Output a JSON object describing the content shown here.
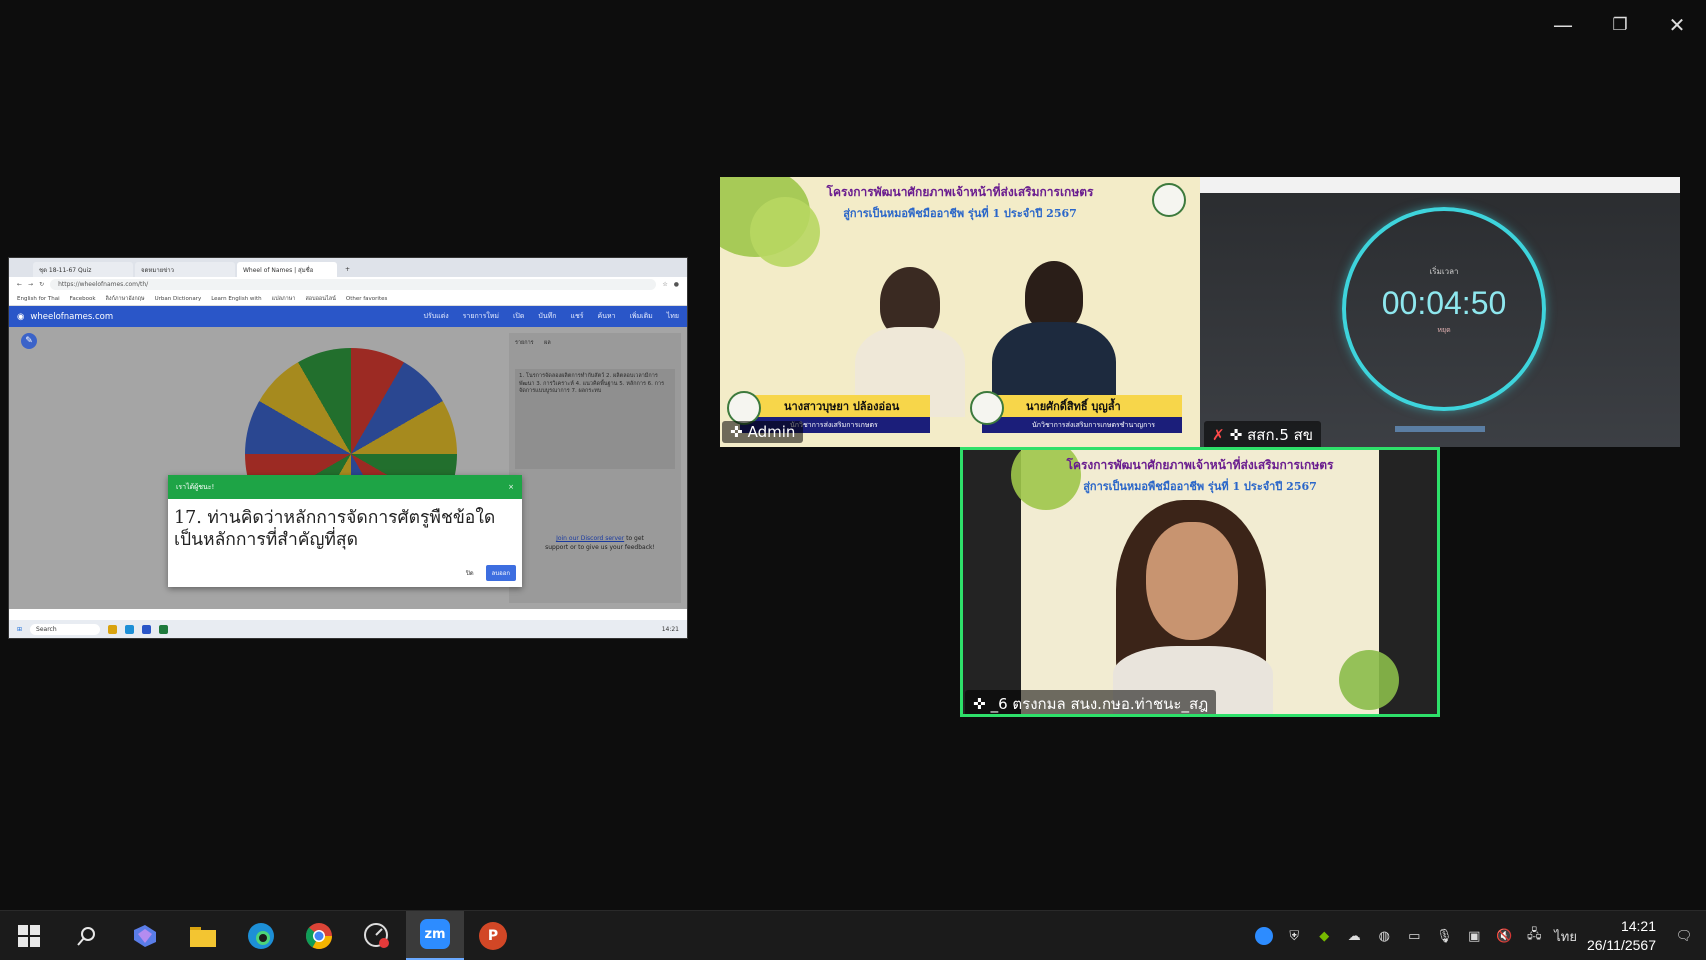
{
  "window": {
    "minimize": "—",
    "restore": "❐",
    "close": "✕"
  },
  "share": {
    "tabs": [
      "ชุด 18-11-67 Quiz",
      "จดหมายข่าว",
      "Wheel of Names | สุ่มชื่อ"
    ],
    "url": "https://wheelofnames.com/th/",
    "bookmarks": [
      "English for Thai",
      "Facebook",
      "ลิงก์ภาษาอังกฤษ",
      "Urban Dictionary",
      "Learn English with",
      "แปลภาษา",
      "สอบออนไลน์",
      "Other favorites"
    ],
    "app_name": "wheelofnames.com",
    "nav": [
      "ปรับแต่ง",
      "รายการใหม่",
      "เปิด",
      "บันทึก",
      "แชร์",
      "ค้นหา",
      "เพิ่มเติม",
      "ไทย"
    ],
    "side_tabs": [
      "รายการ",
      "ผล"
    ],
    "side_list": "1. โนรการจัดลองผลิตการทำกับสัตว์ 2. ผลิตลอบเวลามีการพัฒนา 3. การวิเคราะห์ 4. แนวคิดพื้นฐาน 5. หลักการ 6. การจัดการแบบบูรณาการ 7. ผลกระทบ",
    "discord_link": "Join our Discord server",
    "discord_rest": " to get support or to give us your feedback!",
    "dialog_header": "เราได้ผู้ชนะ!",
    "dialog_question": "17. ท่านคิดว่าหลักการจัดการศัตรูพืชข้อใดเป็นหลักการที่สำคัญที่สุด",
    "dialog_close": "ปิด",
    "dialog_remove": "ลบออก",
    "mini_search": "Search",
    "mini_clock": "14:21"
  },
  "tiles": {
    "hosts": {
      "banner_line1": "โครงการพัฒนาศักยภาพเจ้าหน้าที่ส่งเสริมการเกษตร",
      "banner_line2": "สู่การเป็นหมอพืชมืออาชีพ รุ่นที่ 1 ประจำปี 2567",
      "left_name": "นางสาวบุษยา ปล้องอ่อน",
      "left_title": "นักวิชาการส่งเสริมการเกษตร",
      "right_name": "นายศักดิ์สิทธิ์ บุญล้ำ",
      "right_title": "นักวิชาการส่งเสริมการเกษตรชำนาญการ",
      "label": "Admin"
    },
    "timer": {
      "label": "สสก.5 สข",
      "time": "00:04:50",
      "top_text": "เริ่มเวลา",
      "sub_text": "หยุด"
    },
    "participant": {
      "banner_line1": "โครงการพัฒนาศักยภาพเจ้าหน้าที่ส่งเสริมการเกษตร",
      "banner_line2": "สู่การเป็นหมอพืชมืออาชีพ รุ่นที่ 1 ประจำปี 2567",
      "label": "_6 ตรงกมล สนง.กษอ.ท่าชนะ_สฎ"
    }
  },
  "taskbar": {
    "apps": [
      "start-icon",
      "search-icon",
      "copilot-icon",
      "file-explorer-icon",
      "edge-icon",
      "chrome-icon",
      "screenshot-icon",
      "zoom-icon",
      "powerpoint-icon"
    ],
    "zoom_label": "zm",
    "ppt_label": "P",
    "lang": "ไทย",
    "time": "14:21",
    "date": "26/11/2567"
  },
  "colors": {
    "accent_green": "#1ea446",
    "timer_cyan": "#3ed4dc",
    "wn_blue": "#2a56c8",
    "active_speaker": "#2ee06a"
  }
}
